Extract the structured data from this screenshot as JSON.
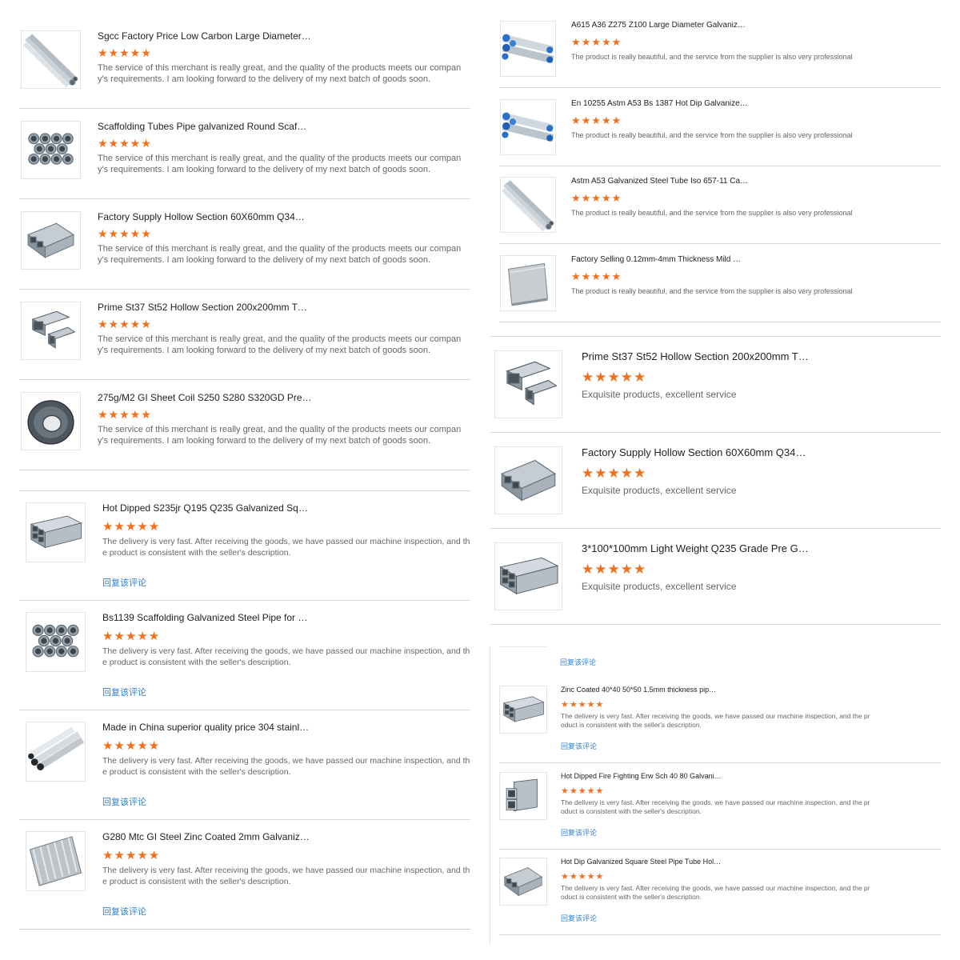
{
  "accent": "#f26f1c",
  "link_color": "#2b7fd9",
  "panel_a": {
    "reviews": [
      {
        "title": "Sgcc Factory Price Low Carbon Large Diameter…",
        "rating": 5,
        "image": "pipe-bundle-icon",
        "text": "The service of this merchant is really great, and the quality of the products meets our company's requirements. I am looking forward to the delivery of my next batch of goods soon."
      },
      {
        "title": "Scaffolding Tubes Pipe galvanized Round Scaf…",
        "rating": 5,
        "image": "pipe-stack-icon",
        "text": "The service of this merchant is really great, and the quality of the products meets our company's requirements. I am looking forward to the delivery of my next batch of goods soon."
      },
      {
        "title": "Factory Supply Hollow Section 60X60mm Q34…",
        "rating": 5,
        "image": "square-tube-icon",
        "text": "The service of this merchant is really great, and the quality of the products meets our company's requirements. I am looking forward to the delivery of my next batch of goods soon."
      },
      {
        "title": "Prime St37 St52 Hollow Section 200x200mm T…",
        "rating": 5,
        "image": "hollow-section-icon",
        "text": "The service of this merchant is really great, and the quality of the products meets our company's requirements. I am looking forward to the delivery of my next batch of goods soon."
      },
      {
        "title": "275g/M2 GI Sheet Coil S250 S280 S320GD Pre…",
        "rating": 5,
        "image": "steel-coil-icon",
        "text": "The service of this merchant is really great, and the quality of the products meets our company's requirements. I am looking forward to the delivery of my next batch of goods soon."
      }
    ]
  },
  "panel_b": {
    "reviews": [
      {
        "title": "A615 A36 Z275 Z100 Large Diameter Galvaniz…",
        "rating": 5,
        "image": "blue-pipe-bundle-icon",
        "text": "The product is really beautiful, and the service from the supplier is also very professional"
      },
      {
        "title": "En 10255 Astm A53 Bs 1387 Hot Dip Galvanize…",
        "rating": 5,
        "image": "blue-pipe-bundle-icon",
        "text": "The product is really beautiful, and the service from the supplier is also very professional"
      },
      {
        "title": "Astm A53 Galvanized Steel Tube Iso 657-11 Ca…",
        "rating": 5,
        "image": "pipe-bundle-icon",
        "text": "The product is really beautiful, and the service from the supplier is also very professional"
      },
      {
        "title": "Factory Selling 0.12mm-4mm Thickness Mild …",
        "rating": 5,
        "image": "steel-sheet-icon",
        "text": "The product is really beautiful, and the service from the supplier is also very professional"
      }
    ]
  },
  "panel_c": {
    "reviews": [
      {
        "title": "Hot Dipped S235jr Q195 Q235 Galvanized Squ…",
        "rating": 5,
        "image": "square-tube-stack-icon",
        "reply": "回复该评论",
        "text": "The delivery is very fast. After receiving the goods, we have passed our machine inspection, and the product is consistent with the seller's description."
      },
      {
        "title": "Bs1139 Scaffolding Galvanized Steel Pipe for …",
        "rating": 5,
        "image": "pipe-stack-icon",
        "reply": "回复该评论",
        "text": "The delivery is very fast. After receiving the goods, we have passed our machine inspection, and the product is consistent with the seller's description."
      },
      {
        "title": "Made in China superior quality price 304 stainl…",
        "rating": 5,
        "image": "stainless-pipe-icon",
        "reply": "回复该评论",
        "text": "The delivery is very fast. After receiving the goods, we have passed our machine inspection, and the product is consistent with the seller's description."
      },
      {
        "title": "G280 Mtc GI Steel Zinc Coated 2mm Galvanize…",
        "rating": 5,
        "image": "corrugated-sheet-icon",
        "reply": "回复该评论",
        "text": "The delivery is very fast. After receiving the goods, we have passed our machine inspection, and the product is consistent with the seller's description."
      }
    ]
  },
  "panel_d": {
    "reviews": [
      {
        "title": "Prime St37 St52 Hollow Section 200x200mm T…",
        "rating": 5,
        "image": "hollow-section-icon",
        "text": "Exquisite products, excellent service"
      },
      {
        "title": "Factory Supply Hollow Section 60X60mm Q34…",
        "rating": 5,
        "image": "square-tube-icon",
        "text": "Exquisite products, excellent service"
      },
      {
        "title": "3*100*100mm Light Weight Q235 Grade Pre G…",
        "rating": 5,
        "image": "square-tube-stack-icon",
        "text": "Exquisite products, excellent service"
      }
    ]
  },
  "panel_e": {
    "top_reply": "回复该评论",
    "reviews": [
      {
        "title": "Zinc Coated 40*40 50*50 1.5mm thickness pip…",
        "rating": 5,
        "image": "square-tube-stack-icon",
        "reply": "回复该评论",
        "text": "The delivery is very fast. After receiving the goods, we have passed our machine inspection, and the product is consistent with the seller's description."
      },
      {
        "title": "Hot Dipped Fire Fighting Erw Sch 40 80 Galvani…",
        "rating": 5,
        "image": "square-tube-end-icon",
        "reply": "回复该评论",
        "text": "The delivery is very fast. After receiving the goods, we have passed our machine inspection, and the product is consistent with the seller's description."
      },
      {
        "title": "Hot Dip Galvanized Square Steel Pipe Tube Hol…",
        "rating": 5,
        "image": "square-tube-icon",
        "reply": "回复该评论",
        "text": "The delivery is very fast. After receiving the goods, we have passed our machine inspection, and the product is consistent with the seller's description."
      }
    ]
  }
}
